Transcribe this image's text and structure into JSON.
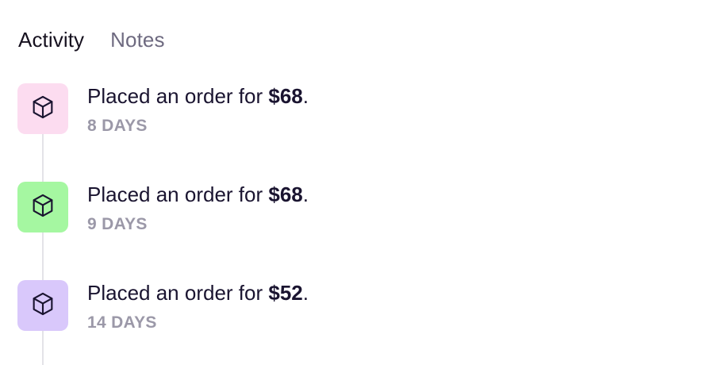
{
  "tabs": [
    {
      "label": "Activity",
      "active": true
    },
    {
      "label": "Notes",
      "active": false
    }
  ],
  "activities": [
    {
      "text_prefix": "Placed an order for ",
      "amount": "$68",
      "text_suffix": ".",
      "time": "8 DAYS",
      "icon": "package-icon",
      "icon_bg": "#fcdcf0"
    },
    {
      "text_prefix": "Placed an order for ",
      "amount": "$68",
      "text_suffix": ".",
      "time": "9 DAYS",
      "icon": "package-icon",
      "icon_bg": "#a5f7a1"
    },
    {
      "text_prefix": "Placed an order for ",
      "amount": "$52",
      "text_suffix": ".",
      "time": "14 DAYS",
      "icon": "package-icon",
      "icon_bg": "#d9c8fb"
    }
  ],
  "colors": {
    "text_primary": "#1a1430",
    "text_muted": "#9b98a8",
    "tab_inactive": "#6e6a80",
    "timeline": "#e4e3e8"
  }
}
